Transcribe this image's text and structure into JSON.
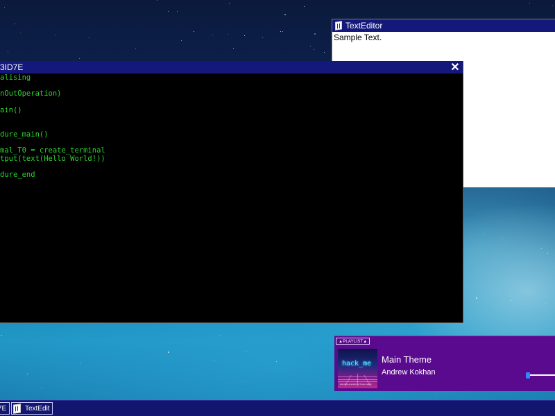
{
  "texteditor": {
    "title": "TextEditor",
    "content": "Sample Text.",
    "icon": "document-icon"
  },
  "terminal": {
    "title": "3ID7E",
    "close_icon": "close-icon",
    "lines": [
      "alising",
      "",
      "nOutOperation)",
      "",
      "ain()",
      "",
      "",
      "dure_main()",
      "",
      "mal_T0 = create_terminal",
      "tput(text(Hello World!))",
      "",
      "dure_end"
    ]
  },
  "player": {
    "playlist_label": "▲PLAYLIST▲",
    "track_title": "Main Theme",
    "artist": "Andrew Kokhan",
    "album_art_title": "hack_me",
    "album_art_subtitle": "alternate operation of frame reality",
    "progress": 0.05
  },
  "taskbar": {
    "items": [
      {
        "label": "7E"
      },
      {
        "label": "TextEdit"
      }
    ]
  },
  "colors": {
    "titlebar": "#14187a",
    "terminal_text": "#2bd42b",
    "player_bg": "#5a0a8e",
    "taskbar_bg": "#13166e"
  }
}
